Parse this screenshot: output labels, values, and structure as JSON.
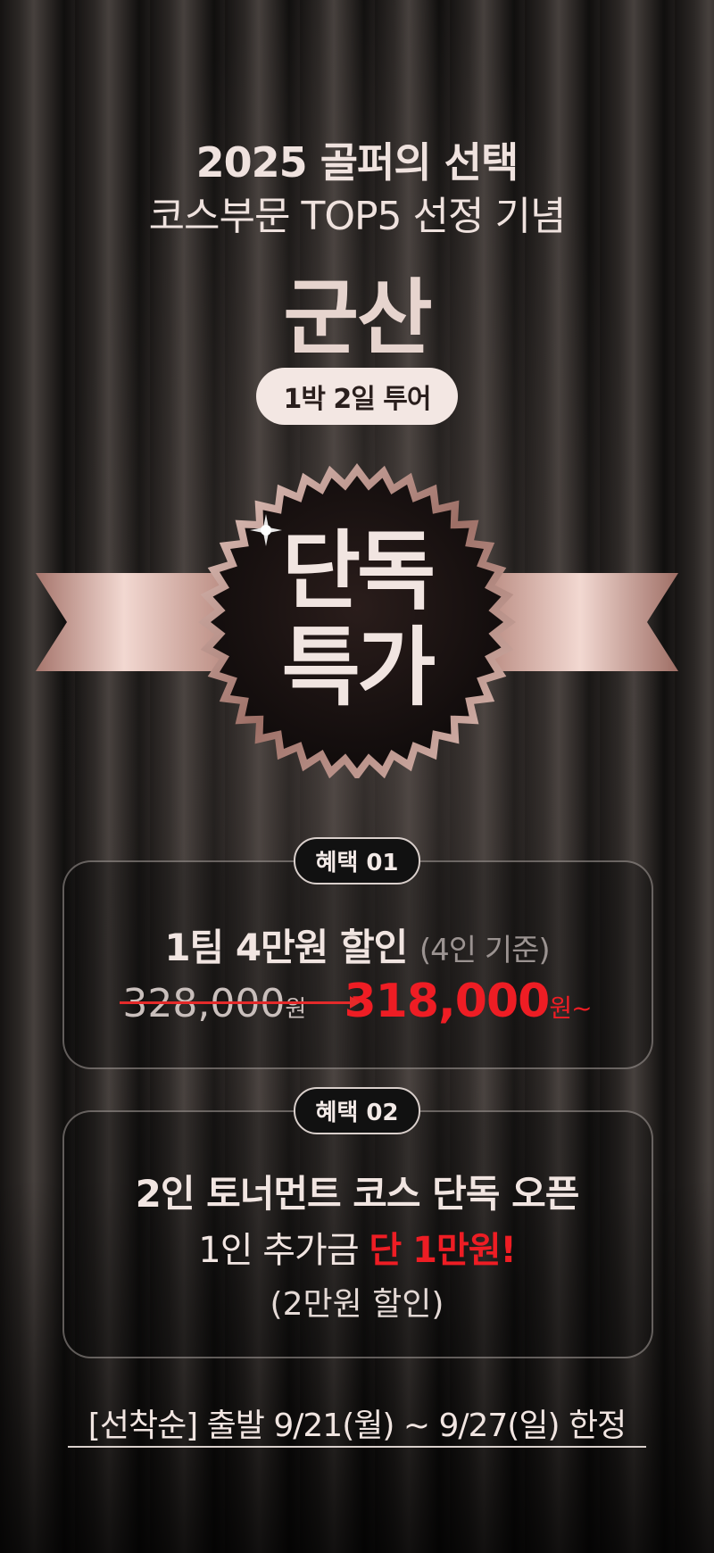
{
  "header": {
    "line1": "2025 골퍼의 선택",
    "line2": "코스부문 TOP5 선정 기념",
    "city": "군산",
    "tour_pill": "1박 2일 투어"
  },
  "emblem": {
    "line1": "단독",
    "line2": "특가",
    "colors": {
      "ribbon": "#c89c91",
      "badge": "#1b1413"
    }
  },
  "benefit1": {
    "badge": "혜택 01",
    "title": "1팀 4만원 할인",
    "title_sub": "(4인 기준)",
    "old_price": "328,000",
    "old_price_unit": "원",
    "new_price": "318,000",
    "new_price_unit": "원~"
  },
  "benefit2": {
    "badge": "혜택 02",
    "line1": "2인 토너먼트 코스 단독 오픈",
    "line2_prefix": "1인 추가금",
    "line2_highlight": "단 1만원!",
    "line3": "(2만원 할인)"
  },
  "footer": {
    "text": "[선착순] 출발 9/21(월) ~ 9/27(일) 한정"
  },
  "colors": {
    "accent_red": "#ee1d24",
    "text_light": "#f1e5e1",
    "pill_bg": "#f3e7e3"
  }
}
